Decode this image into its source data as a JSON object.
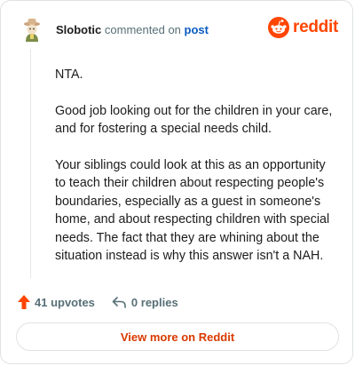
{
  "header": {
    "author": "Slobotic",
    "verb": "commented on",
    "post_link": "post",
    "brand": "reddit"
  },
  "colors": {
    "brand": "#ff4500",
    "link": "#0a5cc2",
    "button_text": "#d93900",
    "muted": "#576f76"
  },
  "icons": {
    "avatar": "user-avatar-icon",
    "brand": "reddit-snoo-icon",
    "upvote": "upvote-arrow-icon",
    "reply": "reply-arrow-icon"
  },
  "comment": {
    "paragraphs": [
      "NTA.",
      "Good job looking out for the children in your care, and for fostering a special needs child.",
      "Your siblings could look at this as an opportunity to teach their children about respecting people's boundaries, especially as a guest in someone's home, and about respecting children with special needs. The fact that they are whining about the situation instead is why this answer isn't a NAH."
    ]
  },
  "actions": {
    "upvotes": "41 upvotes",
    "replies": "0 replies"
  },
  "footer": {
    "view_more": "View more on Reddit"
  }
}
